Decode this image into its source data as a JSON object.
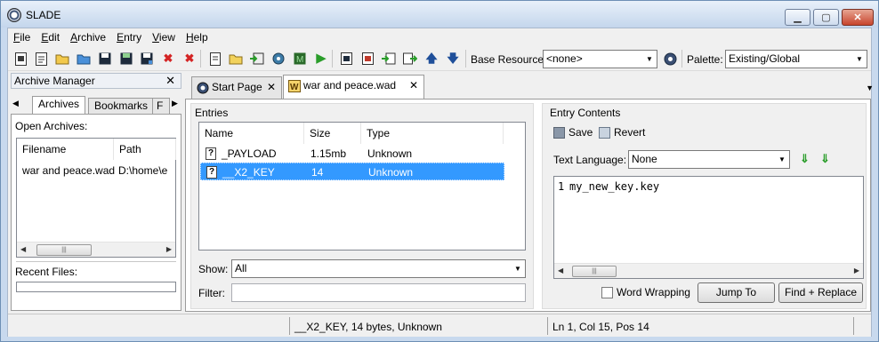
{
  "window": {
    "title": "SLADE"
  },
  "menu": [
    "File",
    "Edit",
    "Archive",
    "Entry",
    "View",
    "Help"
  ],
  "toolbar": {
    "base_resource_label": "Base Resource:",
    "base_resource_value": "<none>",
    "palette_label": "Palette:",
    "palette_value": "Existing/Global"
  },
  "archive_manager": {
    "title": "Archive Manager",
    "tabs": [
      "Archives",
      "Bookmarks",
      "F"
    ],
    "open_archives_label": "Open Archives:",
    "columns": [
      "Filename",
      "Path"
    ],
    "rows": [
      {
        "filename": "war and peace.wad",
        "path": "D:\\home\\e"
      }
    ],
    "recent_files_label": "Recent Files:"
  },
  "doc_tabs": [
    {
      "label": "Start Page"
    },
    {
      "label": "war and peace.wad"
    }
  ],
  "entries": {
    "title": "Entries",
    "columns": [
      "Name",
      "Size",
      "Type"
    ],
    "rows": [
      {
        "name": "_PAYLOAD",
        "size": "1.15mb",
        "type": "Unknown"
      },
      {
        "name": "__X2_KEY",
        "size": "14",
        "type": "Unknown"
      }
    ],
    "show_label": "Show:",
    "show_value": "All",
    "filter_label": "Filter:"
  },
  "entry_contents": {
    "title": "Entry Contents",
    "save_label": "Save",
    "revert_label": "Revert",
    "text_language_label": "Text Language:",
    "text_language_value": "None",
    "line_number": "1",
    "code": "my_new_key.key",
    "word_wrapping_label": "Word Wrapping",
    "jump_to_label": "Jump To",
    "find_replace_label": "Find + Replace"
  },
  "status": {
    "entry_info": "__X2_KEY, 14 bytes, Unknown",
    "cursor_info": "Ln 1, Col 15, Pos 14"
  },
  "colors": {
    "selection": "#3399ff",
    "chrome": "#c8d9ee",
    "play": "#2a9d2a",
    "delete": "#d42424"
  }
}
